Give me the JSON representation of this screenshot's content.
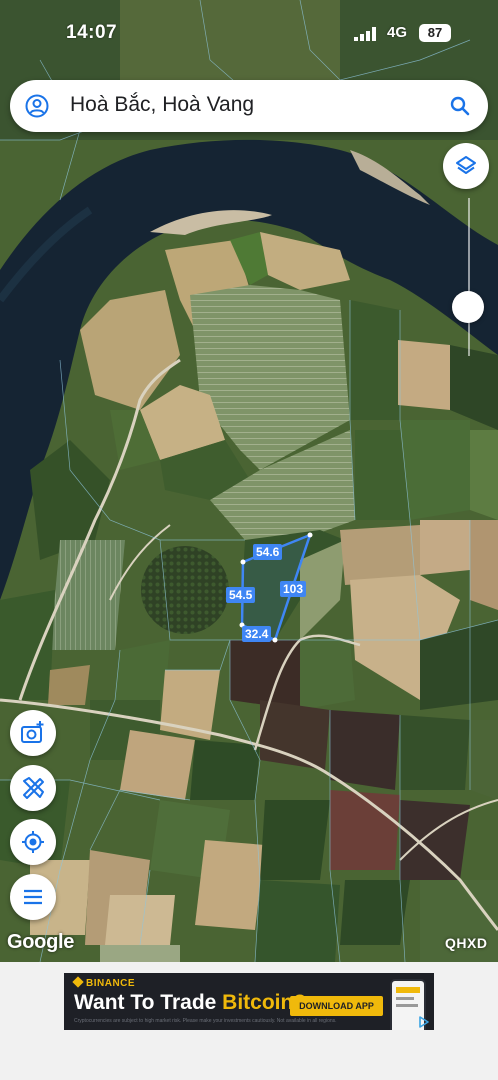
{
  "status_bar": {
    "time": "14:07",
    "network": "4G",
    "battery": "87"
  },
  "search": {
    "query": "Hoà Bắc, Hoà Vang"
  },
  "icons": {
    "profile": "user-circle-icon",
    "search": "search-icon",
    "layers": "layers-icon",
    "camera": "add-photo-icon",
    "measure": "ruler-pencil-icon",
    "locate": "my-location-icon",
    "menu": "menu-icon"
  },
  "parcel": {
    "edges": [
      {
        "id": "top",
        "length": "54.6"
      },
      {
        "id": "right",
        "length": "103"
      },
      {
        "id": "left",
        "length": "54.5"
      },
      {
        "id": "bottom",
        "length": "32.4"
      }
    ]
  },
  "map_overlay": {
    "attribution": "Google",
    "layer_code": "QHXD"
  },
  "ad": {
    "brand": "BINANCE",
    "headline_prefix": "Want To Trade ",
    "headline_highlight": "Bitcoin?",
    "cta": "DOWNLOAD APP",
    "fine_print": "Cryptocurrencies are subject to high market risk. Please make your investments cautiously. Not available in all regions."
  },
  "colors": {
    "parcel_outline": "#3f86f4",
    "ad_accent": "#f0b90b",
    "icon_blue": "#1a73e8"
  }
}
